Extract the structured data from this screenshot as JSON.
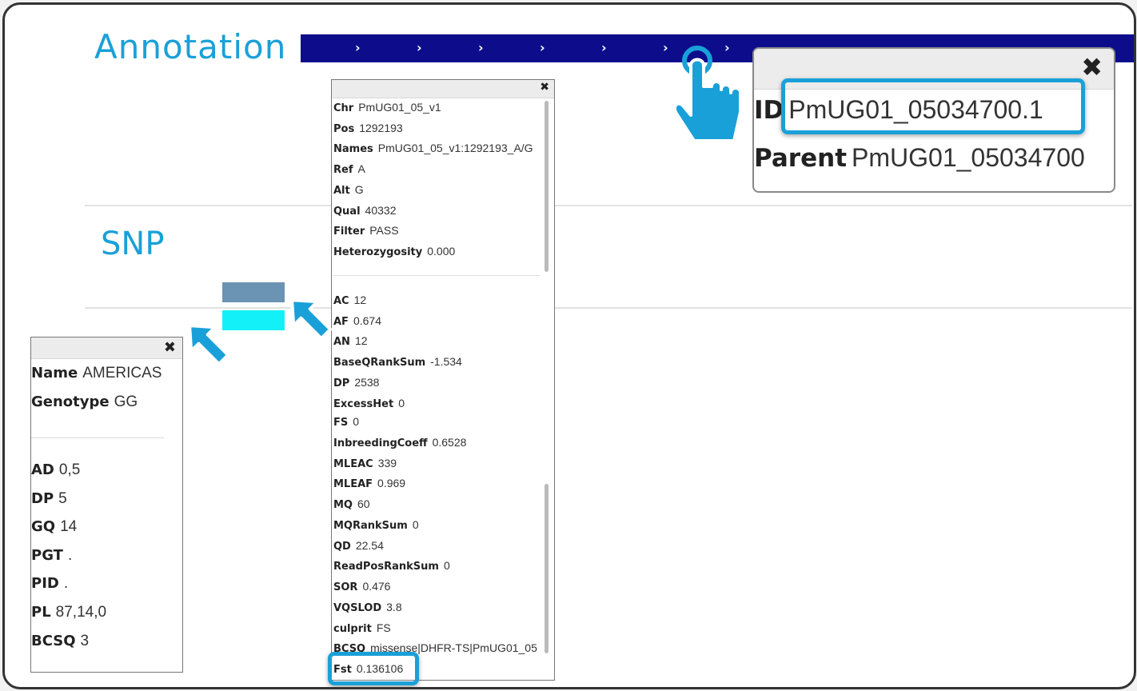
{
  "tracks": {
    "annotation_title": "Annotation",
    "snp_title": "SNP"
  },
  "annotation_bar": {
    "chevron": "›",
    "color": "#0d0d8c"
  },
  "snp_blocks": {
    "top_color": "#6b93b3",
    "bottom_color": "#14f0f8"
  },
  "colors": {
    "accent": "#1aa0d8",
    "title": "#1aa0d8"
  },
  "close_glyph": "✖",
  "variant_popup": {
    "core": [
      {
        "key": "Chr",
        "value": "PmUG01_05_v1"
      },
      {
        "key": "Pos",
        "value": "1292193"
      },
      {
        "key": "Names",
        "value": "PmUG01_05_v1:1292193_A/G"
      },
      {
        "key": "Ref",
        "value": "A"
      },
      {
        "key": "Alt",
        "value": "G"
      },
      {
        "key": "Qual",
        "value": "40332"
      },
      {
        "key": "Filter",
        "value": "PASS"
      },
      {
        "key": "Heterozygosity",
        "value": "0.000"
      }
    ],
    "info": [
      {
        "key": "AC",
        "value": "12"
      },
      {
        "key": "AF",
        "value": "0.674"
      },
      {
        "key": "AN",
        "value": "12"
      },
      {
        "key": "BaseQRankSum",
        "value": "-1.534"
      },
      {
        "key": "DP",
        "value": "2538"
      },
      {
        "key": "ExcessHet",
        "value": "0"
      },
      {
        "key": "FS",
        "value": "0"
      },
      {
        "key": "InbreedingCoeff",
        "value": "0.6528"
      },
      {
        "key": "MLEAC",
        "value": "339"
      },
      {
        "key": "MLEAF",
        "value": "0.969"
      },
      {
        "key": "MQ",
        "value": "60"
      },
      {
        "key": "MQRankSum",
        "value": "0"
      },
      {
        "key": "QD",
        "value": "22.54"
      },
      {
        "key": "ReadPosRankSum",
        "value": "0"
      },
      {
        "key": "SOR",
        "value": "0.476"
      },
      {
        "key": "VQSLOD",
        "value": "3.8"
      },
      {
        "key": "culprit",
        "value": "FS"
      },
      {
        "key": "BCSQ",
        "value": "missense|DHFR-TS|PmUG01_05"
      },
      {
        "key": "Fst",
        "value": "0.136106"
      }
    ]
  },
  "sample_popup": {
    "header": [
      {
        "key": "Name",
        "value": "AMERICAS"
      },
      {
        "key": "Genotype",
        "value": "GG"
      }
    ],
    "fields": [
      {
        "key": "AD",
        "value": "0,5"
      },
      {
        "key": "DP",
        "value": "5"
      },
      {
        "key": "GQ",
        "value": "14"
      },
      {
        "key": "PGT",
        "value": "."
      },
      {
        "key": "PID",
        "value": "."
      },
      {
        "key": "PL",
        "value": "87,14,0"
      },
      {
        "key": "BCSQ",
        "value": "3"
      }
    ]
  },
  "feature_popup": {
    "fields": [
      {
        "key": "ID",
        "value": "PmUG01_05034700.1"
      },
      {
        "key": "Parent",
        "value": "PmUG01_05034700"
      }
    ]
  }
}
